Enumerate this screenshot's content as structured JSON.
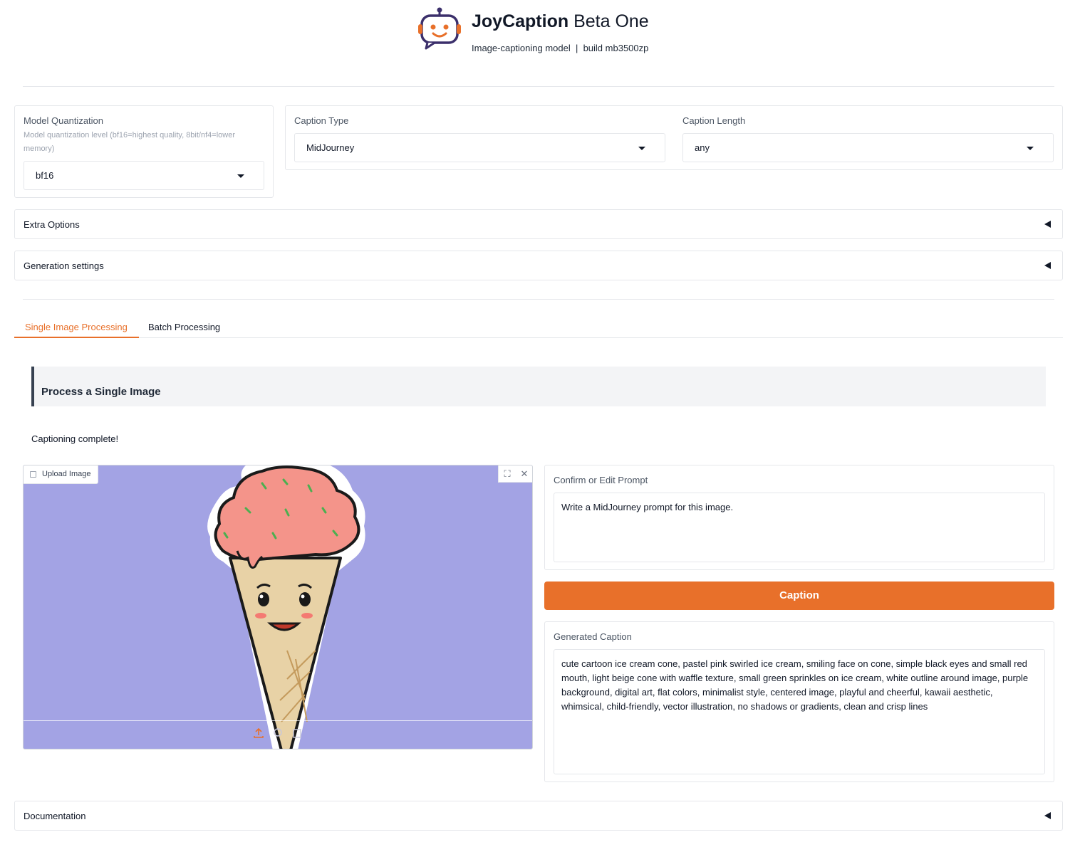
{
  "header": {
    "title_bold": "JoyCaption",
    "title_rest": " Beta One",
    "subtitle": "Image-captioning model  |  build mb3500zp",
    "logo_icon": "robot-chat-icon"
  },
  "model_quantization": {
    "label": "Model Quantization",
    "info": "Model quantization level (bf16=highest quality, 8bit/nf4=lower memory)",
    "value": "bf16"
  },
  "caption_type": {
    "label": "Caption Type",
    "value": "MidJourney"
  },
  "caption_length": {
    "label": "Caption Length",
    "value": "any"
  },
  "accordions": {
    "extra_options": "Extra Options",
    "generation_settings": "Generation settings",
    "documentation": "Documentation"
  },
  "tabs": [
    {
      "label": "Single Image Processing",
      "active": true
    },
    {
      "label": "Batch Processing",
      "active": false
    }
  ],
  "single": {
    "section_title": "Process a Single Image",
    "status": "Captioning complete!",
    "upload_label": "Upload Image",
    "prompt_label": "Confirm or Edit Prompt",
    "prompt_value": "Write a MidJourney prompt for this image.",
    "caption_button": "Caption",
    "generated_label": "Generated Caption",
    "generated_value": "cute cartoon ice cream cone, pastel pink swirled ice cream, smiling face on cone, simple black eyes and small red mouth, light beige cone with waffle texture, small green sprinkles on ice cream, white outline around image, purple background, digital art, flat colors, minimalist style, centered image, playful and cheerful, kawaii aesthetic, whimsical, child-friendly, vector illustration, no shadows or gradients, clean and crisp lines"
  },
  "colors": {
    "accent": "#e8702a",
    "image_background": "#a3a3e4"
  }
}
